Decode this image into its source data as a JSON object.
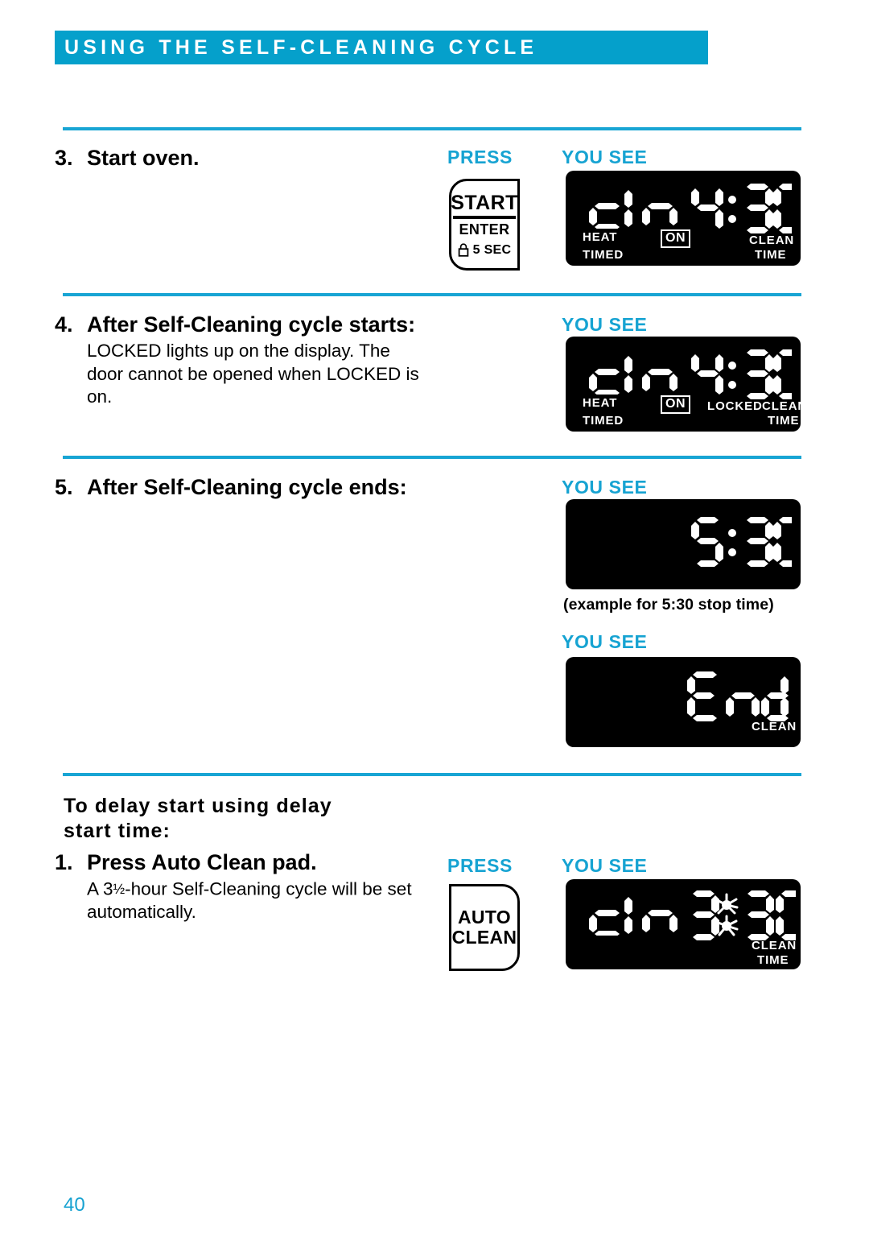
{
  "header": {
    "title": "USING THE SELF-CLEANING CYCLE"
  },
  "colors": {
    "accent": "#05a0cb",
    "rule": "#18a5d4",
    "label": "#16a3d2",
    "page_number": "#17a2d1",
    "display_bg": "#000000",
    "display_fg": "#ffffff"
  },
  "page_number": "40",
  "columns": {
    "press_label": "PRESS",
    "you_see_label": "YOU SEE"
  },
  "steps": [
    {
      "number": "3.",
      "heading": "Start oven.",
      "body": "",
      "press_label": "PRESS",
      "you_see_label": "YOU SEE",
      "pad": {
        "name": "start-pad",
        "line1": "START",
        "line2": "ENTER",
        "line3": "5 SEC",
        "icon": "lock-icon"
      },
      "display": {
        "word": "cln",
        "digits": "4:30",
        "indicators_left": [
          "HEAT",
          "TIMED"
        ],
        "indicator_center": "ON",
        "indicators_right": [
          "CLEAN",
          "TIME"
        ],
        "locked": ""
      }
    },
    {
      "number": "4.",
      "heading": "After Self-Cleaning cycle starts:",
      "body": "LOCKED lights up on the display. The door cannot be opened when LOCKED is on.",
      "press_label": "",
      "you_see_label": "YOU SEE",
      "display": {
        "word": "cln",
        "digits": "4:30",
        "indicators_left": [
          "HEAT",
          "TIMED"
        ],
        "indicator_center": "ON",
        "indicators_right": [
          "CLEAN",
          "TIME"
        ],
        "locked": "LOCKED"
      }
    },
    {
      "number": "5.",
      "heading": "After Self-Cleaning cycle ends:",
      "body": "",
      "you_see_label_1": "YOU SEE",
      "display_1": {
        "digits": "5:30",
        "caption": "(example for 5:30 stop time)"
      },
      "you_see_label_2": "YOU SEE",
      "display_2": {
        "word": "End",
        "indicator_right": "CLEAN"
      }
    }
  ],
  "delay_section": {
    "heading_line1": "To delay start using delay",
    "heading_line2": "start time:",
    "step": {
      "number": "1.",
      "heading": "Press Auto Clean pad.",
      "body_prefix": "A 3",
      "body_fraction": "½",
      "body_suffix": "-hour Self-Cleaning cycle will be set automatically.",
      "press_label": "PRESS",
      "you_see_label": "YOU SEE",
      "pad": {
        "name": "auto-clean-pad",
        "line1": "AUTO",
        "line2": "CLEAN"
      },
      "display": {
        "word": "cln",
        "digits": "3:30",
        "flashing": true,
        "indicators_right": [
          "CLEAN",
          "TIME"
        ]
      }
    }
  }
}
